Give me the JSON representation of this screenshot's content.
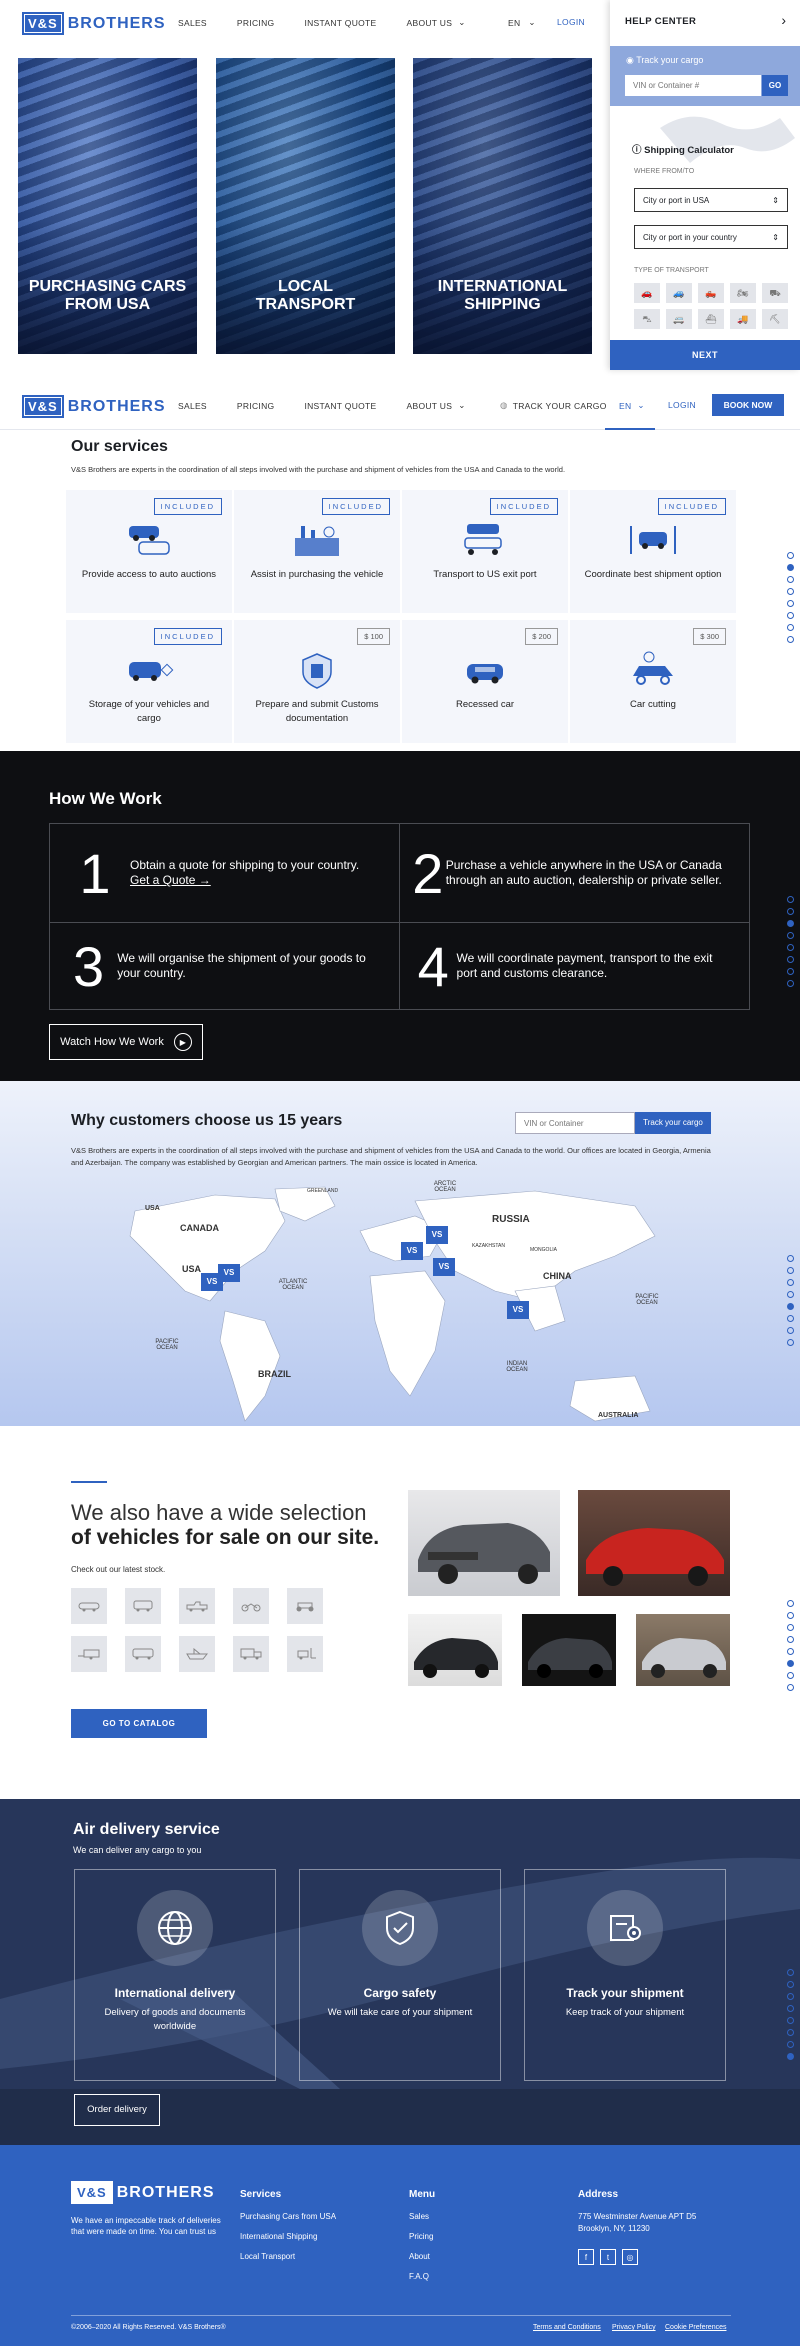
{
  "brand": {
    "vs": "V&S",
    "name": "BROTHERS"
  },
  "nav": {
    "sales": "SALES",
    "pricing": "PRICING",
    "quote": "INSTANT QUOTE",
    "about": "ABOUT US",
    "lang": "EN",
    "login": "LOGIN",
    "track": "TRACK YOUR CARGO",
    "book": "BOOK NOW"
  },
  "hero": {
    "cards": [
      "PURCHASING CARS FROM USA",
      "LOCAL TRANSPORT",
      "INTERNATIONAL SHIPPING"
    ]
  },
  "help": {
    "title": "HELP CENTER",
    "track_title": "Track your cargo",
    "vin_placeholder": "VIN or Container #",
    "go": "GO",
    "calc_title": "Shipping Calculator",
    "where": "WHERE FROM/TO",
    "from": "City or port in USA",
    "to": "City or port in your country",
    "type": "TYPE OF TRANSPORT",
    "next": "NEXT"
  },
  "services": {
    "title": "Our services",
    "desc": "V&S Brothers are experts in the coordination of all steps involved with the purchase and shipment of vehicles from the USA and Canada to the world.",
    "items": [
      {
        "tag": "INCLUDED",
        "label": "Provide access to auto auctions"
      },
      {
        "tag": "INCLUDED",
        "label": "Assist in purchasing the vehicle"
      },
      {
        "tag": "INCLUDED",
        "label": "Transport to US exit port"
      },
      {
        "tag": "INCLUDED",
        "label": "Coordinate best shipment option"
      },
      {
        "tag": "INCLUDED",
        "label": "Storage of your vehicles and cargo"
      },
      {
        "tag": "$ 100",
        "label": "Prepare and submit Customs documentation"
      },
      {
        "tag": "$ 200",
        "label": "Recessed car"
      },
      {
        "tag": "$ 300",
        "label": "Car cutting"
      }
    ]
  },
  "how": {
    "title": "How We Work",
    "steps": [
      {
        "n": "1",
        "text": "Obtain a quote for shipping to your country.",
        "link": "Get a Quote →"
      },
      {
        "n": "2",
        "text": "Purchase a vehicle anywhere in the USA or Canada through an auto auction, dealership or private seller."
      },
      {
        "n": "3",
        "text": "We will organise the shipment of your goods to your country."
      },
      {
        "n": "4",
        "text": "We will coordinate payment, transport to the exit port and customs clearance."
      }
    ],
    "watch": "Watch How We Work"
  },
  "why": {
    "title": "Why customers choose us 15 years",
    "input_placeholder": "VIN or Container",
    "button": "Track your cargo",
    "desc": "V&S Brothers are experts in the coordination of all steps involved with the purchase and shipment of vehicles from the USA and Canada to the world. Our offices are located in Georgia, Armenia and Azerbaijan. The company was established by Georgian and American partners. The main ossice is located in America.",
    "map_labels": [
      "USA",
      "CANADA",
      "GREENLAND",
      "ARCTIC OCEAN",
      "RUSSIA",
      "CHINA",
      "USA",
      "ATLANTIC OCEAN",
      "PACIFIC OCEAN",
      "PACIFIC OCEAN",
      "BRAZIL",
      "INDIAN OCEAN",
      "AUSTRALIA",
      "KAZAKHSTAN",
      "MONGOLIA"
    ],
    "marker": "VS"
  },
  "vehicles": {
    "line1": "We also have a wide selection",
    "line2": "of vehicles for sale on our site.",
    "sub": "Check out our latest stock.",
    "button": "GO TO CATALOG"
  },
  "air": {
    "title": "Air delivery service",
    "sub": "We can deliver any cargo to you",
    "cards": [
      {
        "title": "International delivery",
        "text": "Delivery of goods and documents worldwide"
      },
      {
        "title": "Cargo safety",
        "text": "We will take care of your shipment"
      },
      {
        "title": "Track your shipment",
        "text": "Keep track of your shipment"
      }
    ],
    "button": "Order delivery"
  },
  "footer": {
    "about": "We have an impeccable track of deliveries that were made on time. You can trust us",
    "services_title": "Services",
    "services": [
      "Purchasing Cars from USA",
      "International Shipping",
      "Local Transport"
    ],
    "menu_title": "Menu",
    "menu": [
      "Sales",
      "Pricing",
      "About",
      "F.A.Q"
    ],
    "address_title": "Address",
    "address1": "775 Westminster Avenue APT D5",
    "address2": "Brooklyn, NY, 11230",
    "social": [
      "f",
      "t",
      "◎"
    ],
    "copyright": "©2006–2020 All Rights Reserved. V&S Brothers®",
    "terms": "Terms and Conditions",
    "privacy": "Privacy Policy",
    "cookie": "Cookie Preferences"
  },
  "colors": {
    "brand": "#2f62c0",
    "dark": "#0e0f12",
    "air": "#2a3a5c"
  }
}
